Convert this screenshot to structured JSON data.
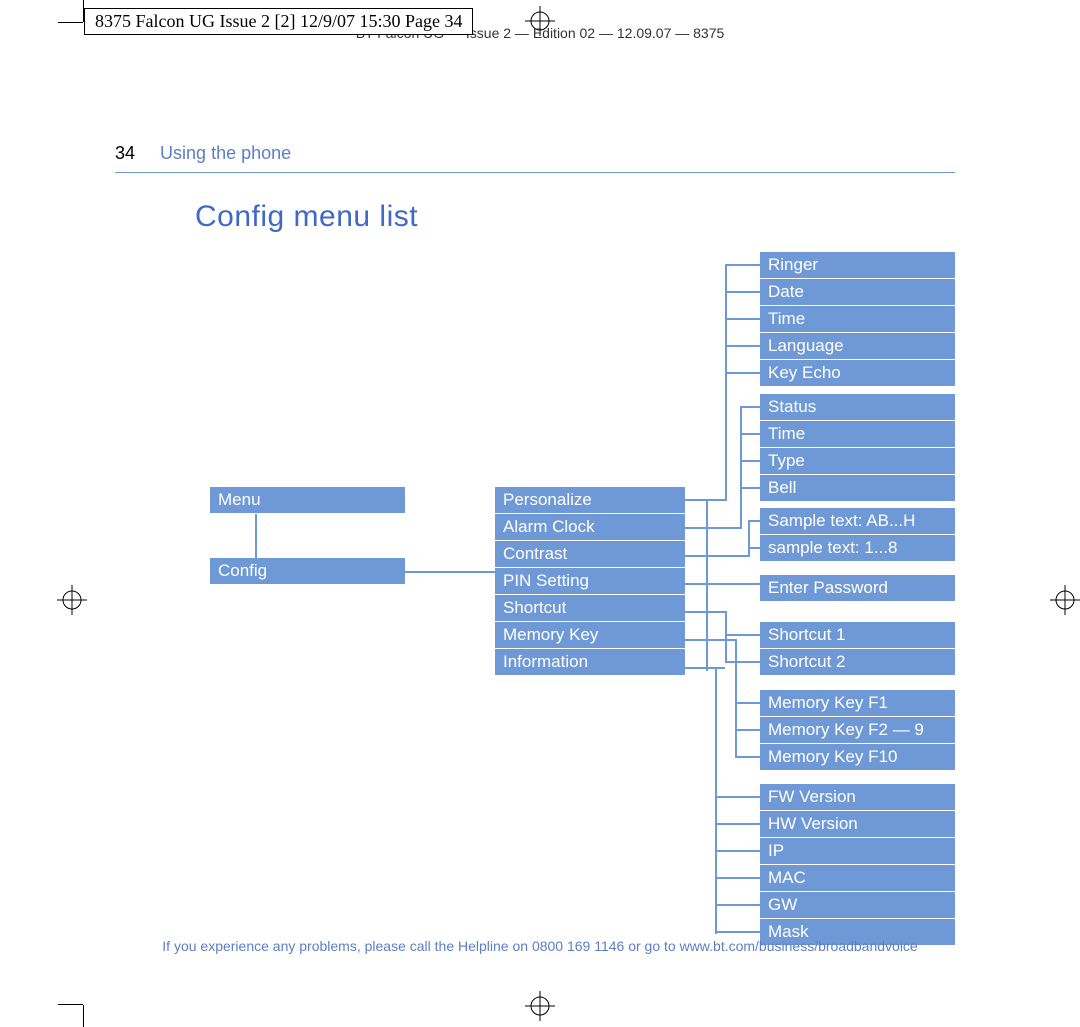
{
  "meta": {
    "slug": "8375 Falcon UG Issue 2 [2]  12/9/07  15:30  Page 34",
    "header2": "BT Falcon UG — Issue 2 — Edition 02 — 12.09.07 — 8375"
  },
  "runhead": {
    "page": "34",
    "section": "Using the phone"
  },
  "title": "Config menu list",
  "col1": {
    "menu": "Menu",
    "config": "Config"
  },
  "col2": {
    "items": [
      "Personalize",
      "Alarm Clock",
      "Contrast",
      "PIN Setting",
      "Shortcut",
      "Memory Key",
      "Information"
    ]
  },
  "col3": {
    "grp_personalize": [
      "Ringer",
      "Date",
      "Time",
      "Language",
      "Key Echo"
    ],
    "grp_alarm": [
      "Status",
      "Time",
      "Type",
      "Bell"
    ],
    "grp_contrast": [
      "Sample text: AB...H",
      "sample text: 1...8"
    ],
    "grp_pin": [
      "Enter Password"
    ],
    "grp_shortcut": [
      "Shortcut 1",
      "Shortcut 2"
    ],
    "grp_memory": [
      "Memory Key F1",
      "Memory Key F2 — 9",
      "Memory Key F10"
    ],
    "grp_info": [
      "FW Version",
      "HW Version",
      "IP",
      "MAC",
      "GW",
      "Mask"
    ]
  },
  "footer": "If you experience any problems, please call the Helpline on 0800 169 1146 or go to www.bt.com/business/broadbandvoice"
}
